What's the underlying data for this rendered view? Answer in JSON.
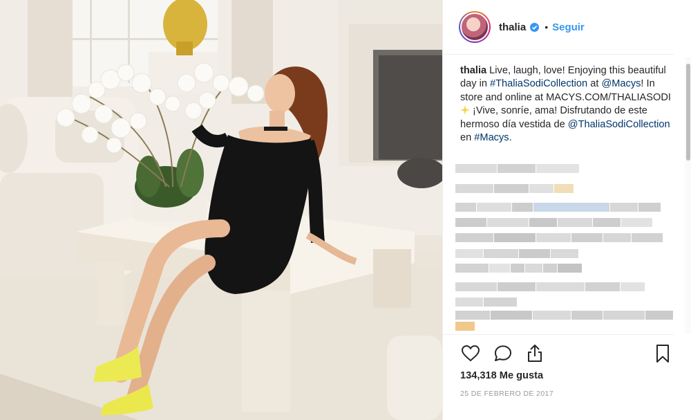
{
  "post": {
    "username": "thalia",
    "separator": "•",
    "follow_label": "Seguir",
    "caption": {
      "username": "thalia",
      "part1": " Live, laugh, love! Enjoying this beautiful day in ",
      "tag1": "#ThaliaSodiCollection",
      "part2": " at ",
      "tag2": "@Macys",
      "part3": "! In store and online at MACYS.COM/THALIASODI ",
      "part4": " ¡Vive, sonríe, ama! Disfrutando de este hermoso día vestida de ",
      "tag3": "@ThaliaSodiCollection",
      "part5": " en ",
      "tag4": "#Macys",
      "part6": "."
    },
    "likes": "134,318 Me gusta",
    "date": "25 DE FEBRERO DE 2017"
  },
  "icons": {
    "verified": "verified-badge-icon",
    "sparkle": "sparkle-emoji-icon",
    "like": "heart-icon",
    "comment": "comment-bubble-icon",
    "share": "share-icon",
    "save": "bookmark-icon"
  },
  "colors": {
    "link": "#3897f0",
    "hashtag": "#003569",
    "text": "#262626",
    "muted": "#999999"
  }
}
